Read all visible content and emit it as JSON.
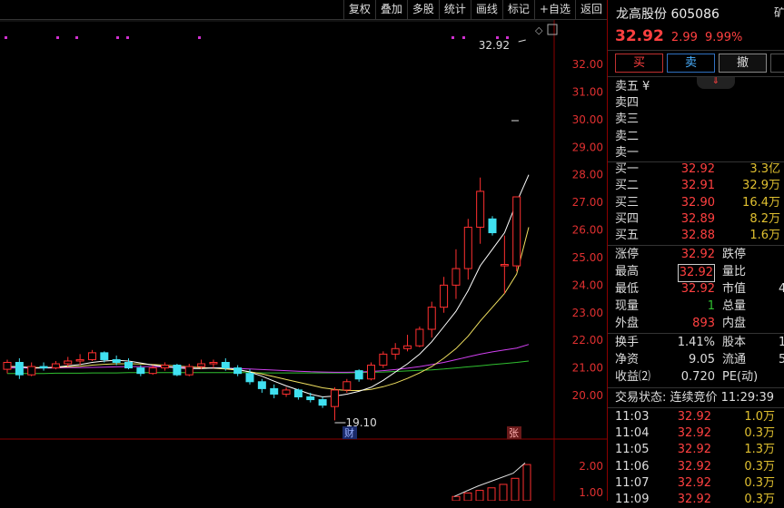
{
  "toolbar": {
    "items": [
      "复权",
      "叠加",
      "多股",
      "统计",
      "画线",
      "标记",
      "+自选",
      "返回"
    ]
  },
  "chart": {
    "price_axis": [
      "32.00",
      "31.00",
      "30.00",
      "29.00",
      "28.00",
      "27.00",
      "26.00",
      "25.00",
      "24.00",
      "23.00",
      "22.00",
      "21.00",
      "20.00"
    ],
    "volume_axis": [
      "2.00",
      "1.00"
    ],
    "high_label": "32.92",
    "low_label": "19.10",
    "badge_cai": "财",
    "badge_zhang": "张",
    "colors": {
      "up": "#ff3030",
      "down": "#40e0f0",
      "ma5": "#ffffff",
      "ma10": "#f0e060",
      "ma20": "#d040f0",
      "ma60": "#30c030"
    }
  },
  "chart_data": {
    "type": "candlestick",
    "candles": [
      {
        "o": 20.95,
        "h": 21.3,
        "l": 20.8,
        "c": 21.2
      },
      {
        "o": 21.2,
        "h": 21.35,
        "l": 20.6,
        "c": 20.75
      },
      {
        "o": 20.75,
        "h": 21.2,
        "l": 20.7,
        "c": 21.05
      },
      {
        "o": 21.05,
        "h": 21.2,
        "l": 20.9,
        "c": 21.0
      },
      {
        "o": 21.0,
        "h": 21.25,
        "l": 20.95,
        "c": 21.15
      },
      {
        "o": 21.15,
        "h": 21.4,
        "l": 21.05,
        "c": 21.25
      },
      {
        "o": 21.25,
        "h": 21.5,
        "l": 21.1,
        "c": 21.3
      },
      {
        "o": 21.3,
        "h": 21.65,
        "l": 21.25,
        "c": 21.55
      },
      {
        "o": 21.55,
        "h": 21.6,
        "l": 21.2,
        "c": 21.3
      },
      {
        "o": 21.3,
        "h": 21.45,
        "l": 21.1,
        "c": 21.2
      },
      {
        "o": 21.2,
        "h": 21.35,
        "l": 20.95,
        "c": 21.0
      },
      {
        "o": 21.0,
        "h": 21.1,
        "l": 20.7,
        "c": 20.8
      },
      {
        "o": 20.8,
        "h": 21.1,
        "l": 20.75,
        "c": 21.0
      },
      {
        "o": 21.0,
        "h": 21.2,
        "l": 20.9,
        "c": 21.1
      },
      {
        "o": 21.1,
        "h": 21.15,
        "l": 20.7,
        "c": 20.75
      },
      {
        "o": 20.75,
        "h": 21.15,
        "l": 20.7,
        "c": 21.05
      },
      {
        "o": 21.05,
        "h": 21.3,
        "l": 20.95,
        "c": 21.15
      },
      {
        "o": 21.15,
        "h": 21.3,
        "l": 21.0,
        "c": 21.2
      },
      {
        "o": 21.2,
        "h": 21.35,
        "l": 20.9,
        "c": 21.0
      },
      {
        "o": 21.0,
        "h": 21.1,
        "l": 20.7,
        "c": 20.8
      },
      {
        "o": 20.8,
        "h": 20.95,
        "l": 20.4,
        "c": 20.5
      },
      {
        "o": 20.5,
        "h": 20.6,
        "l": 20.1,
        "c": 20.25
      },
      {
        "o": 20.25,
        "h": 20.4,
        "l": 19.9,
        "c": 20.05
      },
      {
        "o": 20.05,
        "h": 20.3,
        "l": 19.95,
        "c": 20.2
      },
      {
        "o": 20.2,
        "h": 20.25,
        "l": 19.85,
        "c": 19.95
      },
      {
        "o": 19.95,
        "h": 20.1,
        "l": 19.75,
        "c": 19.85
      },
      {
        "o": 19.85,
        "h": 19.95,
        "l": 19.55,
        "c": 19.65
      },
      {
        "o": 19.6,
        "h": 20.3,
        "l": 19.1,
        "c": 20.2
      },
      {
        "o": 20.2,
        "h": 20.6,
        "l": 20.1,
        "c": 20.5
      },
      {
        "o": 20.9,
        "h": 20.95,
        "l": 20.5,
        "c": 20.6
      },
      {
        "o": 20.6,
        "h": 21.2,
        "l": 20.55,
        "c": 21.1
      },
      {
        "o": 21.1,
        "h": 21.6,
        "l": 21.0,
        "c": 21.5
      },
      {
        "o": 21.5,
        "h": 21.9,
        "l": 21.3,
        "c": 21.7
      },
      {
        "o": 21.7,
        "h": 22.2,
        "l": 21.6,
        "c": 21.8
      },
      {
        "o": 21.8,
        "h": 22.5,
        "l": 21.75,
        "c": 22.4
      },
      {
        "o": 22.4,
        "h": 23.4,
        "l": 22.1,
        "c": 23.2
      },
      {
        "o": 23.2,
        "h": 24.3,
        "l": 23.0,
        "c": 24.0
      },
      {
        "o": 24.0,
        "h": 25.3,
        "l": 23.5,
        "c": 24.6
      },
      {
        "o": 24.6,
        "h": 26.4,
        "l": 24.2,
        "c": 26.1
      },
      {
        "o": 26.1,
        "h": 27.9,
        "l": 25.5,
        "c": 27.4
      },
      {
        "o": 26.4,
        "h": 26.5,
        "l": 25.8,
        "c": 25.9
      },
      {
        "o": 24.7,
        "h": 25.8,
        "l": 23.7,
        "c": 24.75
      },
      {
        "o": 24.7,
        "h": 27.2,
        "l": 24.5,
        "c": 27.2
      }
    ],
    "ma5": [
      21.05,
      21.05,
      21.0,
      21.0,
      21.03,
      21.08,
      21.12,
      21.2,
      21.25,
      21.28,
      21.25,
      21.18,
      21.1,
      21.05,
      21.0,
      20.98,
      20.98,
      21.0,
      21.0,
      20.95,
      20.85,
      20.7,
      20.52,
      20.35,
      20.2,
      20.05,
      19.95,
      19.98,
      20.05,
      20.15,
      20.3,
      20.55,
      20.85,
      21.15,
      21.5,
      21.95,
      22.5,
      23.05,
      23.8,
      24.7,
      25.3,
      25.9,
      27.0
    ],
    "ma10": [
      21.05,
      21.04,
      21.02,
      21.01,
      21.02,
      21.04,
      21.06,
      21.1,
      21.13,
      21.15,
      21.15,
      21.14,
      21.12,
      21.1,
      21.07,
      21.04,
      21.01,
      20.99,
      20.96,
      20.92,
      20.86,
      20.78,
      20.68,
      20.58,
      20.48,
      20.38,
      20.28,
      20.22,
      20.18,
      20.18,
      20.22,
      20.32,
      20.45,
      20.62,
      20.82,
      21.05,
      21.35,
      21.7,
      22.15,
      22.7,
      23.2,
      23.7,
      24.4
    ],
    "ma20": [
      21.0,
      21.0,
      21.0,
      21.0,
      21.0,
      21.01,
      21.01,
      21.02,
      21.03,
      21.04,
      21.05,
      21.05,
      21.05,
      21.04,
      21.03,
      21.02,
      21.01,
      21.0,
      20.99,
      20.98,
      20.96,
      20.94,
      20.92,
      20.9,
      20.88,
      20.86,
      20.85,
      20.84,
      20.84,
      20.85,
      20.87,
      20.9,
      20.94,
      20.99,
      21.05,
      21.12,
      21.2,
      21.3,
      21.4,
      21.5,
      21.58,
      21.65,
      21.72
    ],
    "ma60": [
      20.8,
      20.8,
      20.8,
      20.8,
      20.81,
      20.81,
      20.81,
      20.82,
      20.82,
      20.82,
      20.83,
      20.83,
      20.83,
      20.83,
      20.83,
      20.83,
      20.83,
      20.83,
      20.83,
      20.83,
      20.83,
      20.82,
      20.82,
      20.82,
      20.82,
      20.82,
      20.82,
      20.82,
      20.82,
      20.83,
      20.84,
      20.85,
      20.87,
      20.89,
      20.91,
      20.93,
      20.96,
      21.0,
      21.04,
      21.08,
      21.12,
      21.16,
      21.2
    ],
    "volume_ma": [
      0.25,
      0.55,
      0.85,
      1.1,
      1.35,
      1.6,
      2.2
    ],
    "ylim": [
      19.0,
      32.9
    ]
  },
  "stock": {
    "name": "龙高股份 605086",
    "price": "32.92",
    "change": "2.99",
    "pct": "9.99%",
    "corner": "矿"
  },
  "trade": {
    "buy": "买",
    "sell": "卖",
    "cancel": "撤"
  },
  "order_book": {
    "asks": [
      {
        "label": "卖五",
        "price": "¥",
        "vol": ""
      },
      {
        "label": "卖四",
        "price": "",
        "vol": ""
      },
      {
        "label": "卖三",
        "price": "",
        "vol": ""
      },
      {
        "label": "卖二",
        "price": "",
        "vol": ""
      },
      {
        "label": "卖一",
        "price": "",
        "vol": ""
      }
    ],
    "bids": [
      {
        "label": "买一",
        "price": "32.92",
        "vol": "3.3亿"
      },
      {
        "label": "买二",
        "price": "32.91",
        "vol": "32.9万"
      },
      {
        "label": "买三",
        "price": "32.90",
        "vol": "16.4万"
      },
      {
        "label": "买四",
        "price": "32.89",
        "vol": "8.2万"
      },
      {
        "label": "买五",
        "price": "32.88",
        "vol": "1.6万"
      }
    ]
  },
  "quote": {
    "zt_label": "涨停",
    "zt": "32.92",
    "dt_label": "跌停",
    "high_label": "最高",
    "high": "32.92",
    "lb_label": "量比",
    "low_label": "最低",
    "low": "32.92",
    "sz_label": "市值",
    "sz": "4",
    "xl_label": "现量",
    "xl": "1",
    "zl_label": "总量",
    "wp_label": "外盘",
    "wp": "893",
    "np_label": "内盘",
    "hs_label": "换手",
    "hs": "1.41%",
    "gb_label": "股本",
    "gb": "1",
    "jz_label": "净资",
    "jz": "9.05",
    "lt_label": "流通",
    "lt": "5",
    "sy_label": "收益⑵",
    "sy": "0.720",
    "pe_label": "PE(动)"
  },
  "status": {
    "text": "交易状态: 连续竞价 11:29:39"
  },
  "ticks": [
    {
      "time": "11:03",
      "price": "32.92",
      "vol": "1.0万"
    },
    {
      "time": "11:04",
      "price": "32.92",
      "vol": "0.3万"
    },
    {
      "time": "11:05",
      "price": "32.92",
      "vol": "1.3万"
    },
    {
      "time": "11:06",
      "price": "32.92",
      "vol": "0.3万"
    },
    {
      "time": "11:07",
      "price": "32.92",
      "vol": "0.3万"
    },
    {
      "time": "11:09",
      "price": "32.92",
      "vol": "0.3万"
    }
  ]
}
